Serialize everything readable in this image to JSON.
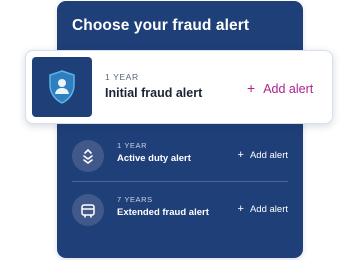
{
  "panel": {
    "title": "Choose your fraud alert"
  },
  "featured": {
    "duration": "1 YEAR",
    "name": "Initial fraud alert",
    "add_label": "Add alert",
    "icon": "shield-person-icon"
  },
  "options": [
    {
      "duration": "1 YEAR",
      "name": "Active duty alert",
      "add_label": "Add alert",
      "icon": "military-chevron-icon"
    },
    {
      "duration": "7 YEARS",
      "name": "Extended fraud alert",
      "add_label": "Add alert",
      "icon": "calendar-icon"
    }
  ],
  "colors": {
    "panel_bg": "#1f3f78",
    "accent": "#b0228c",
    "card_bg": "#ffffff"
  }
}
